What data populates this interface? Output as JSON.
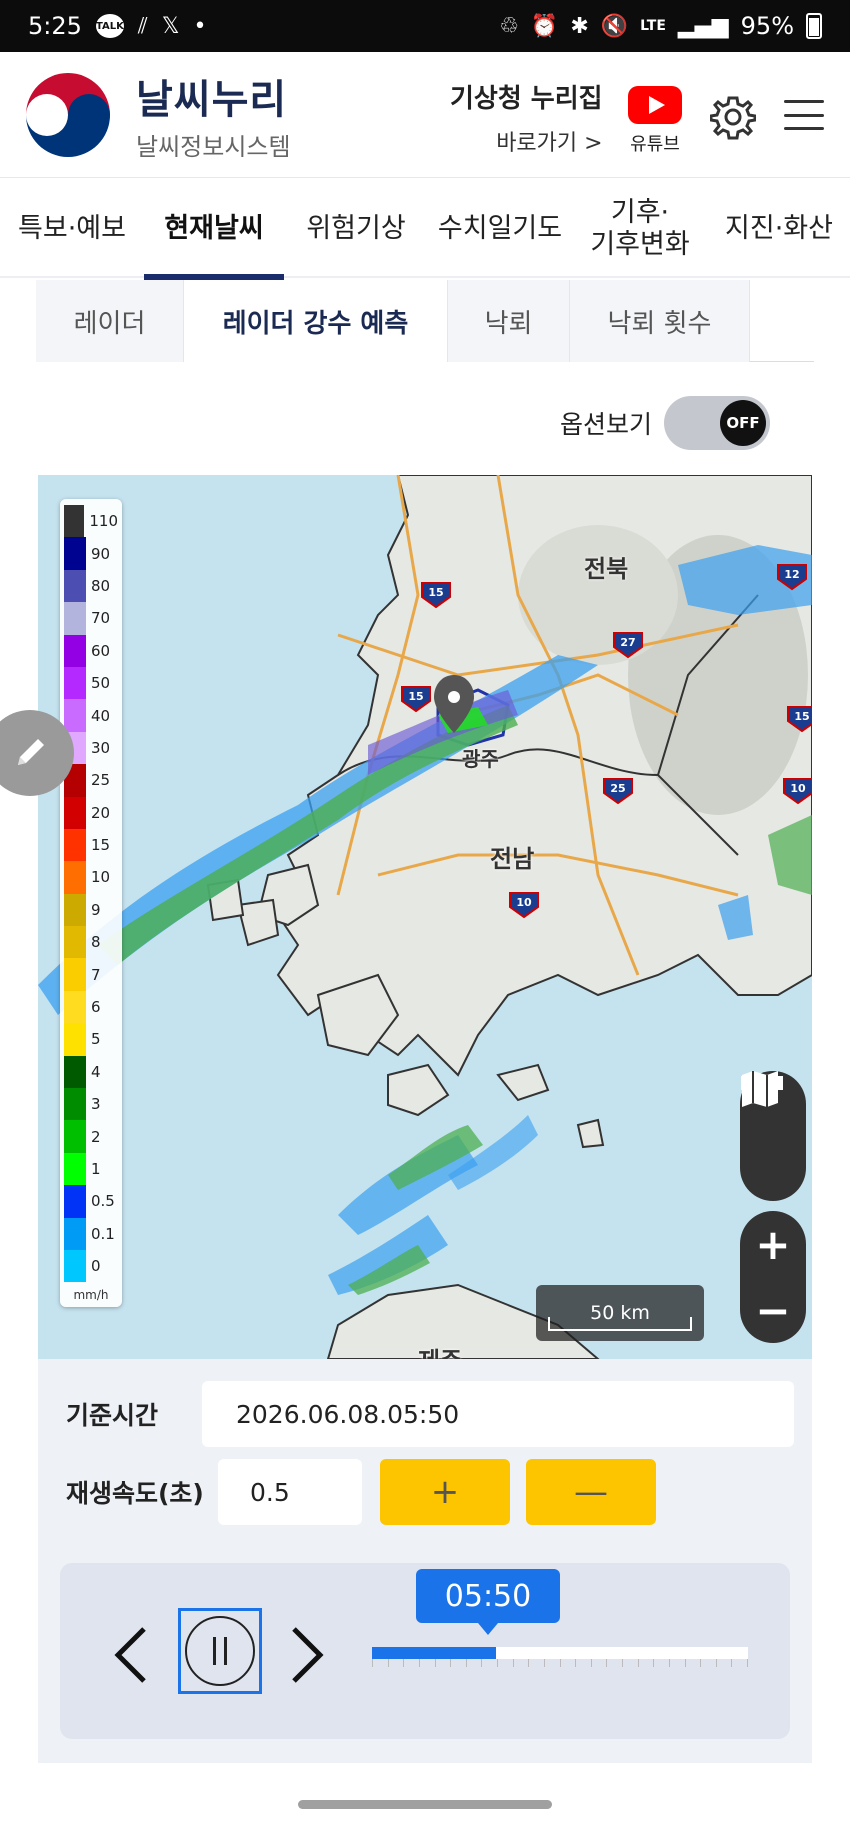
{
  "status_bar": {
    "time": "5:25",
    "talk_badge": "TALK",
    "network": "LTE",
    "battery": "95%"
  },
  "header": {
    "brand_title": "날씨누리",
    "brand_subtitle": "날씨정보시스템",
    "nuri_title": "기상청 누리집",
    "nuri_link": "바로가기 >",
    "youtube_label": "유튜브"
  },
  "nav_tabs": [
    {
      "label": "특보·예보",
      "active": false
    },
    {
      "label": "현재날씨",
      "active": true
    },
    {
      "label": "위험기상",
      "active": false
    },
    {
      "label": "수치일기도",
      "active": false
    },
    {
      "label": "기후·\n기후변화",
      "active": false
    },
    {
      "label": "지진·화산",
      "active": false
    }
  ],
  "sub_tabs": [
    {
      "label": "레이더",
      "active": false
    },
    {
      "label": "레이더 강수 예측",
      "active": true
    },
    {
      "label": "낙뢰",
      "active": false
    },
    {
      "label": "낙뢰 횟수",
      "active": false
    }
  ],
  "options": {
    "label": "옵션보기",
    "toggle_state": "OFF"
  },
  "map": {
    "regions": [
      "전북",
      "광주",
      "전남",
      "제주"
    ],
    "highway_shields": [
      "15",
      "27",
      "15",
      "25",
      "10",
      "12",
      "15",
      "10"
    ],
    "scale_label": "50 km",
    "legend": {
      "unit": "mm/h",
      "levels": [
        {
          "value": "110",
          "color": "#333333"
        },
        {
          "value": "90",
          "color": "#000390"
        },
        {
          "value": "80",
          "color": "#4c4eb1"
        },
        {
          "value": "70",
          "color": "#b3b4de"
        },
        {
          "value": "60",
          "color": "#9300e4"
        },
        {
          "value": "50",
          "color": "#b329ff"
        },
        {
          "value": "40",
          "color": "#c96bff"
        },
        {
          "value": "30",
          "color": "#e0a9ff"
        },
        {
          "value": "25",
          "color": "#b40000"
        },
        {
          "value": "20",
          "color": "#d20000"
        },
        {
          "value": "15",
          "color": "#ff3200"
        },
        {
          "value": "10",
          "color": "#ff6e00"
        },
        {
          "value": "9",
          "color": "#ccaa00"
        },
        {
          "value": "8",
          "color": "#e0b900"
        },
        {
          "value": "7",
          "color": "#f9cd00"
        },
        {
          "value": "6",
          "color": "#ffdc1f"
        },
        {
          "value": "5",
          "color": "#ffe100"
        },
        {
          "value": "4",
          "color": "#005a00"
        },
        {
          "value": "3",
          "color": "#008c00"
        },
        {
          "value": "2",
          "color": "#00be00"
        },
        {
          "value": "1",
          "color": "#00ff00"
        },
        {
          "value": "0.5",
          "color": "#0033f5"
        },
        {
          "value": "0.1",
          "color": "#009bf5"
        },
        {
          "value": "0",
          "color": "#00c8ff"
        }
      ]
    }
  },
  "controls": {
    "base_time_label": "기준시간",
    "base_time_value": "2026.06.08.05:50",
    "speed_label": "재생속도(초)",
    "speed_value": "0.5",
    "plus_label": "+",
    "minus_label": "—",
    "current_time": "05:50",
    "progress_fraction": 0.33
  },
  "colors": {
    "accent_navy": "#1a2c6b",
    "accent_blue": "#1a73e8",
    "button_yellow": "#fdc500"
  }
}
